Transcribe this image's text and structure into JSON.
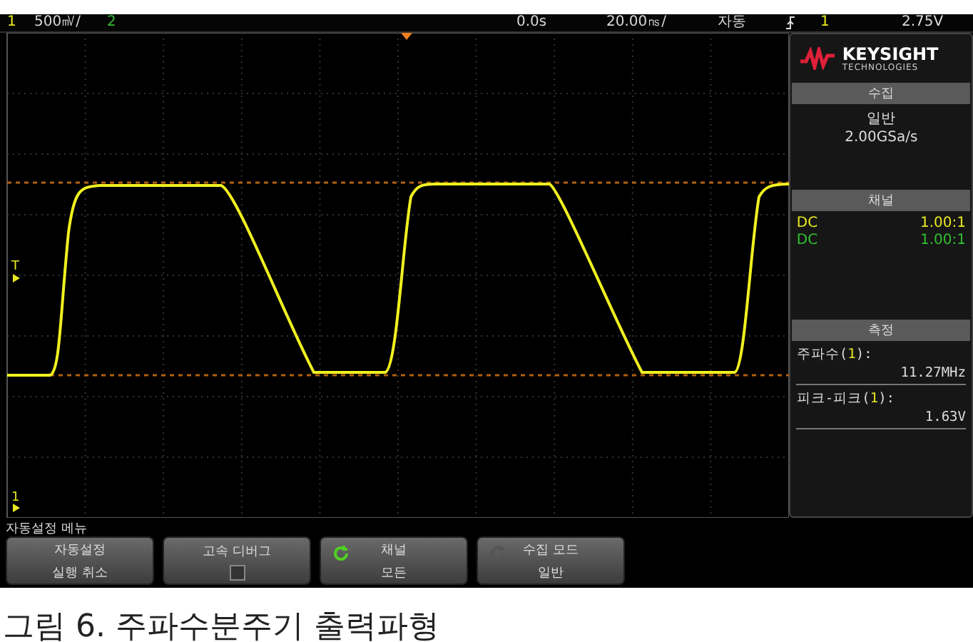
{
  "status_bar": [
    {
      "text": "1",
      "color": "#e8e820"
    },
    {
      "text": "500㎷/"
    },
    {
      "text": "2",
      "color": "#30c030"
    },
    {
      "text": "0.0s"
    },
    {
      "text": "20.00㎱/"
    },
    {
      "text": "자동"
    }
  ],
  "trigger": {
    "source": "1",
    "level": "2.75V"
  },
  "markers": [
    {
      "text": "T"
    },
    {
      "text": "1"
    }
  ],
  "logo": {
    "name": "KEYSIGHT",
    "sub": "TECHNOLOGIES"
  },
  "acquisition": {
    "title": "수집",
    "mode": "일반",
    "rate": "2.00GSa/s"
  },
  "channels": {
    "title": "채널",
    "rows": [
      {
        "coupling": "DC",
        "probe": "1.00:1",
        "color": "#e8e820"
      },
      {
        "coupling": "DC",
        "probe": "1.00:1",
        "color": "#30c030"
      }
    ]
  },
  "measurements": {
    "title": "측정",
    "items": [
      {
        "before": "주파수(",
        "channel": "1",
        "after": "):",
        "value": "11.27MHz"
      },
      {
        "before": "피크-피크(",
        "channel": "1",
        "after": "):",
        "value": "1.63V"
      }
    ]
  },
  "menu": {
    "title": "자동설정 메뉴",
    "softkeys": [
      {
        "kind": "text",
        "lines": [
          "자동설정",
          "실행 취소"
        ]
      },
      {
        "kind": "checkbox",
        "lines": [
          "고속 디버그"
        ],
        "checked": false
      },
      {
        "kind": "rotary",
        "lines": [
          "채널",
          "모든"
        ],
        "active": true
      },
      {
        "kind": "rotary",
        "lines": [
          "수집 모드",
          "일반"
        ],
        "active": false
      }
    ]
  },
  "caption": "그림 6. 주파수분주기 출력파형"
}
